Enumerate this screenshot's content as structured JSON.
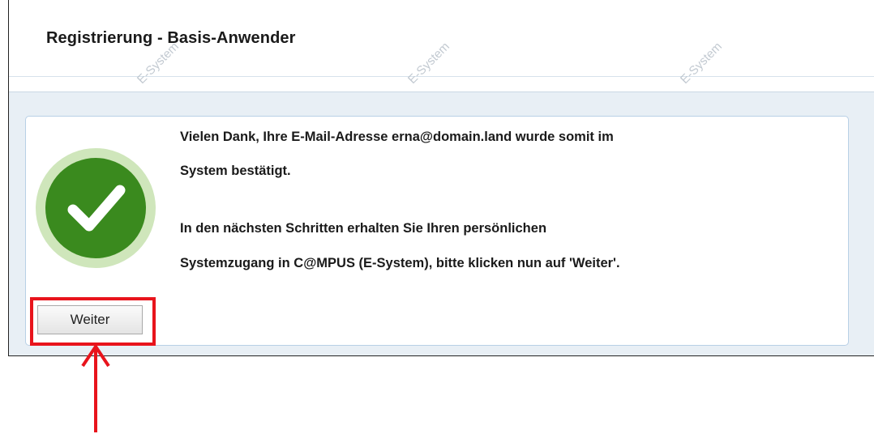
{
  "header": {
    "title": "Registrierung - Basis-Anwender"
  },
  "message": {
    "line1": "Vielen Dank, Ihre E-Mail-Adresse erna@domain.land wurde somit im",
    "line2": "System bestätigt.",
    "line3": "In den nächsten Schritten erhalten Sie Ihren persönlichen",
    "line4": "Systemzugang in C@MPUS (E-System), bitte klicken nun auf 'Weiter'."
  },
  "actions": {
    "weiter_label": "Weiter"
  },
  "watermark": {
    "text": "E-System"
  },
  "icons": {
    "success": "check-circle-icon",
    "annotation": "arrow-up-icon"
  },
  "colors": {
    "success_green": "#3a8a1e",
    "success_halo": "#cfe6bb",
    "annotation_red": "#e8141c",
    "panel_background": "#e8eff5"
  }
}
